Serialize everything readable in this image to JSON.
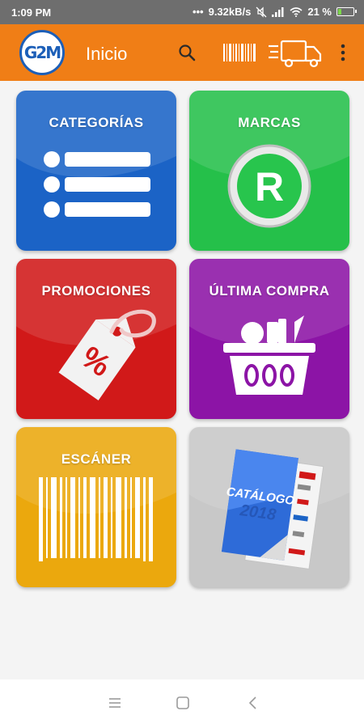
{
  "status_bar": {
    "time": "1:09 PM",
    "network_speed": "9.32kB/s",
    "battery_percent": "21 %",
    "battery_level": 0.21
  },
  "app_bar": {
    "logo_text": "G2M",
    "title": "Inicio",
    "icons": [
      "search-icon",
      "barcode-icon",
      "delivery-truck-icon",
      "more-vert-icon"
    ]
  },
  "tiles": [
    {
      "label": "CATEGORÍAS",
      "color": "#1b63c6",
      "icon": "list-icon"
    },
    {
      "label": "MARCAS",
      "color": "#25c04a",
      "icon": "registered-icon"
    },
    {
      "label": "PROMOCIONES",
      "color": "#d11919",
      "icon": "price-tag-icon"
    },
    {
      "label": "ÚLTIMA COMPRA",
      "color": "#8c14a6",
      "icon": "basket-icon"
    },
    {
      "label": "ESCÁNER",
      "color": "#eba80d",
      "icon": "barcode-icon"
    },
    {
      "label": "",
      "color": "#c8c8c8",
      "icon": "catalog-icon",
      "catalog_cover_title": "CATÁLOGO",
      "catalog_cover_year": "2018"
    }
  ],
  "nav_bar": {
    "icons": [
      "recents-icon",
      "home-icon",
      "back-icon"
    ]
  }
}
